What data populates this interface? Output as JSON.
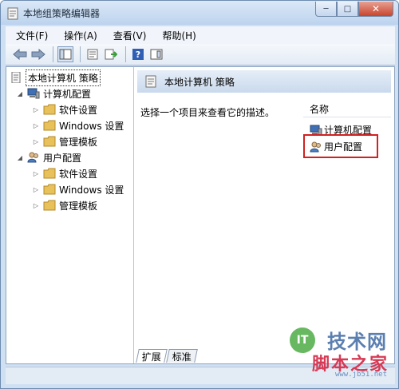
{
  "window": {
    "title": "本地组策略编辑器",
    "controls": {
      "minimize": "─",
      "maximize": "□",
      "close": "✕"
    }
  },
  "menu": [
    "文件(F)",
    "操作(A)",
    "查看(V)",
    "帮助(H)"
  ],
  "toolbar": {
    "icons": [
      "back-arrow-icon",
      "forward-arrow-icon",
      "show-tree-icon",
      "properties-icon",
      "export-list-icon",
      "help-icon",
      "show-pane-icon"
    ],
    "help_glyph": "?"
  },
  "tree": {
    "root": "本地计算机 策略",
    "computer": "计算机配置",
    "computer_children": [
      "软件设置",
      "Windows 设置",
      "管理模板"
    ],
    "user": "用户配置",
    "user_children": [
      "软件设置",
      "Windows 设置",
      "管理模板"
    ],
    "expand_glyph": "◢",
    "collapsed_glyph": "▷"
  },
  "right_pane": {
    "header_title": "本地计算机 策略",
    "description": "选择一个项目来查看它的描述。",
    "column_header": "名称",
    "items": [
      "计算机配置",
      "用户配置"
    ]
  },
  "tabs": [
    "扩展",
    "标准"
  ],
  "watermark": {
    "logo": "IT",
    "line1": "技术网",
    "line2": "脚本之家",
    "line3": "www.jb51.net"
  },
  "colors": {
    "folder": "#e8c15a",
    "highlight_border": "#d32020",
    "titlebar": "#bcd3ee"
  }
}
